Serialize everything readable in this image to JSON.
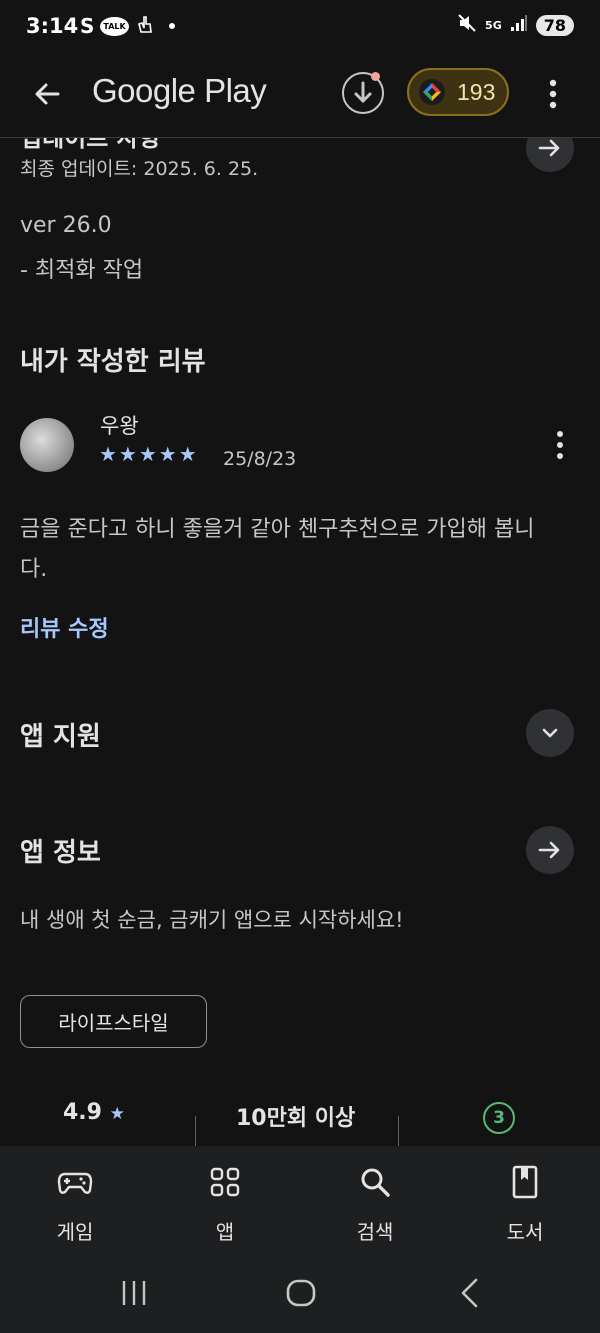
{
  "status_bar": {
    "time": "3:14",
    "left_icons": [
      "S",
      "TALK"
    ],
    "network": "5G",
    "battery": "78"
  },
  "app_bar": {
    "brand": "Google Play",
    "points": "193"
  },
  "whats_new": {
    "updated": "최종 업데이트: 2025. 6. 25.",
    "note_version": "ver 26.0",
    "note_item": "- 최적화 작업"
  },
  "my_review": {
    "title": "내가 작성한 리뷰",
    "reviewer": "우왕",
    "stars": "★★★★★",
    "date": "25/8/23",
    "text": "금을 준다고 하니 좋을거 같아 첸구추천으로 가입해 봅니다.",
    "edit_label": "리뷰 수정"
  },
  "app_support": {
    "title": "앱 지원"
  },
  "about": {
    "title": "앱 정보",
    "description": "내 생애 첫 순금, 금캐기 앱으로 시작하세요!",
    "category": "라이프스타일"
  },
  "stats": {
    "rating": "4.9",
    "rating_star": "★",
    "downloads": "10만회 이상",
    "content_rating": "3"
  },
  "bottom_nav": [
    {
      "label": "게임",
      "icon": "gamepad-icon"
    },
    {
      "label": "앱",
      "icon": "apps-grid-icon"
    },
    {
      "label": "검색",
      "icon": "search-icon"
    },
    {
      "label": "도서",
      "icon": "book-icon"
    }
  ],
  "colors": {
    "background": "#131314",
    "accent": "#a8c7fa",
    "points_bg": "#3d3212",
    "rating_green": "#5bb974"
  }
}
